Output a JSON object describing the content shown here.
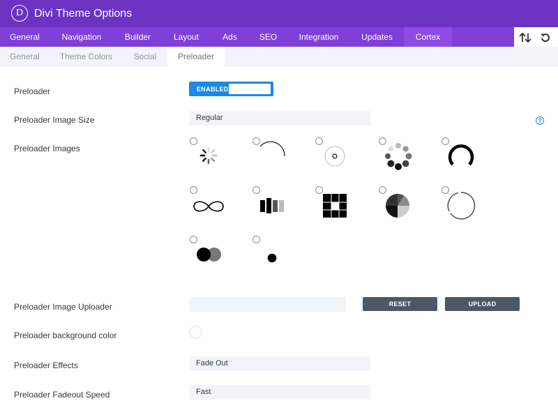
{
  "app": {
    "logo_letter": "D",
    "title": "Divi Theme Options"
  },
  "main_tabs": [
    "General",
    "Navigation",
    "Builder",
    "Layout",
    "Ads",
    "SEO",
    "Integration",
    "Updates",
    "Cortex"
  ],
  "active_main_tab": "Cortex",
  "sub_tabs": [
    "General",
    "Theme Colors",
    "Social",
    "Preloader"
  ],
  "active_sub_tab": "Preloader",
  "fields": {
    "preloader": {
      "label": "Preloader",
      "value": "ENABLED"
    },
    "image_size": {
      "label": "Preloader Image Size",
      "value": "Regular"
    },
    "images": {
      "label": "Preloader Images"
    },
    "uploader": {
      "label": "Preloader Image Uploader",
      "value": "",
      "reset_label": "RESET",
      "upload_label": "UPLOAD"
    },
    "bg_color": {
      "label": "Preloader background color"
    },
    "effects": {
      "label": "Preloader Effects",
      "value": "Fade Out"
    },
    "fadeout_speed": {
      "label": "Preloader Fadeout Speed",
      "value": "Fast"
    }
  },
  "help_glyph": "?",
  "preloader_images": [
    "dots-spinner",
    "arc-spinner",
    "ring-dot-spinner",
    "circle-dots-spinner",
    "thick-arc-spinner",
    "infinity-spinner",
    "bars-spinner",
    "grid-spinner",
    "pie-spinner",
    "broken-ring-spinner",
    "two-circles-spinner",
    "single-dot-spinner"
  ],
  "icons": {
    "sort": "sort-arrows-icon",
    "reset": "undo-icon",
    "help": "help-icon"
  },
  "colors": {
    "title_bar": "#6d32c2",
    "main_nav": "#7f3fd8",
    "active_tab": "#8f4be6",
    "toggle": "#1a8ae6",
    "button": "#4c5866"
  }
}
